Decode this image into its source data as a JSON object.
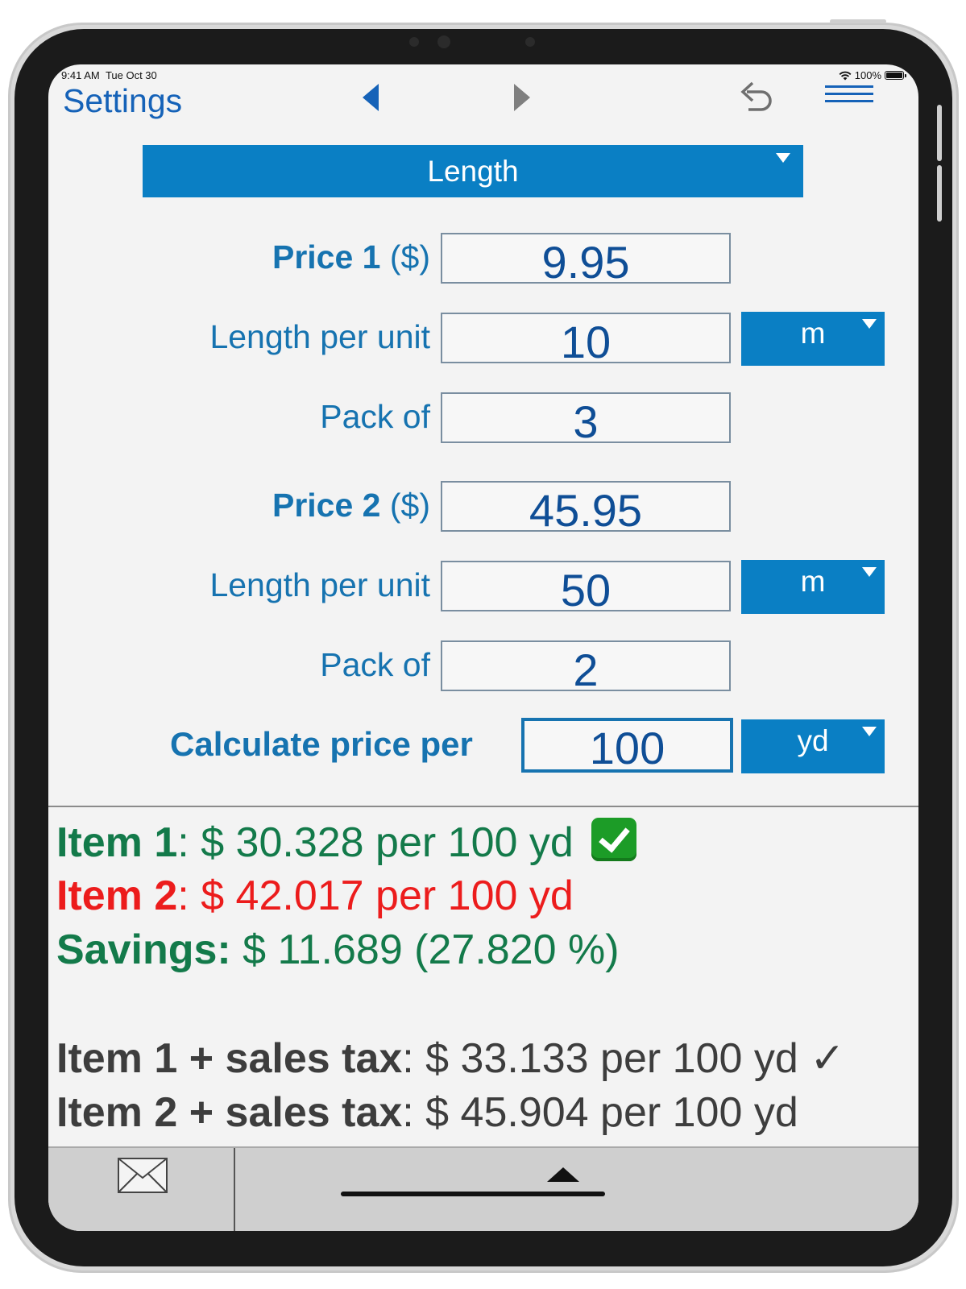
{
  "status": {
    "time": "9:41 AM",
    "date": "Tue Oct 30",
    "battery": "100%"
  },
  "nav": {
    "settings_label": "Settings"
  },
  "category": {
    "selected": "Length"
  },
  "item1": {
    "price_label_bold": "Price 1",
    "price_label_unit": "($)",
    "price_value": "9.95",
    "length_label": "Length per unit",
    "length_value": "10",
    "length_unit": "m",
    "pack_label": "Pack of",
    "pack_value": "3"
  },
  "item2": {
    "price_label_bold": "Price 2",
    "price_label_unit": "($)",
    "price_value": "45.95",
    "length_label": "Length per unit",
    "length_value": "50",
    "length_unit": "m",
    "pack_label": "Pack of",
    "pack_value": "2"
  },
  "calc": {
    "label": "Calculate price per",
    "value": "100",
    "unit": "yd"
  },
  "results": {
    "item1_label": "Item 1",
    "item1_text": ": $ 30.328 per 100 yd",
    "item2_label": "Item 2",
    "item2_text": ": $ 42.017 per 100 yd",
    "savings_label": "Savings:",
    "savings_text": " $ 11.689 (27.820 %)",
    "tax1_label": "Item 1 + sales tax",
    "tax1_text": ": $ 33.133 per 100 yd ✓",
    "tax2_label": "Item 2 + sales tax",
    "tax2_text": ": $ 45.904 per 100 yd"
  },
  "colors": {
    "accent": "#0a7fc4",
    "label_blue": "#1673b0",
    "best_green": "#137a4a",
    "worse_red": "#ec1c1c"
  }
}
